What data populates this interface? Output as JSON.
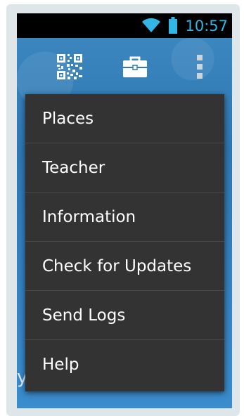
{
  "status_bar": {
    "time": "10:57",
    "wifi_icon": "wifi-icon",
    "battery_icon": "battery-icon",
    "accent_color": "#33b5e5"
  },
  "action_bar": {
    "qr_icon": "qr-code-icon",
    "briefcase_icon": "briefcase-icon",
    "overflow_icon": "overflow-menu-icon"
  },
  "menu": {
    "items": [
      {
        "label": "Places"
      },
      {
        "label": "Teacher"
      },
      {
        "label": "Information"
      },
      {
        "label": "Check for Updates"
      },
      {
        "label": "Send Logs"
      },
      {
        "label": "Help"
      }
    ]
  },
  "background": {
    "partial_text": "y"
  }
}
